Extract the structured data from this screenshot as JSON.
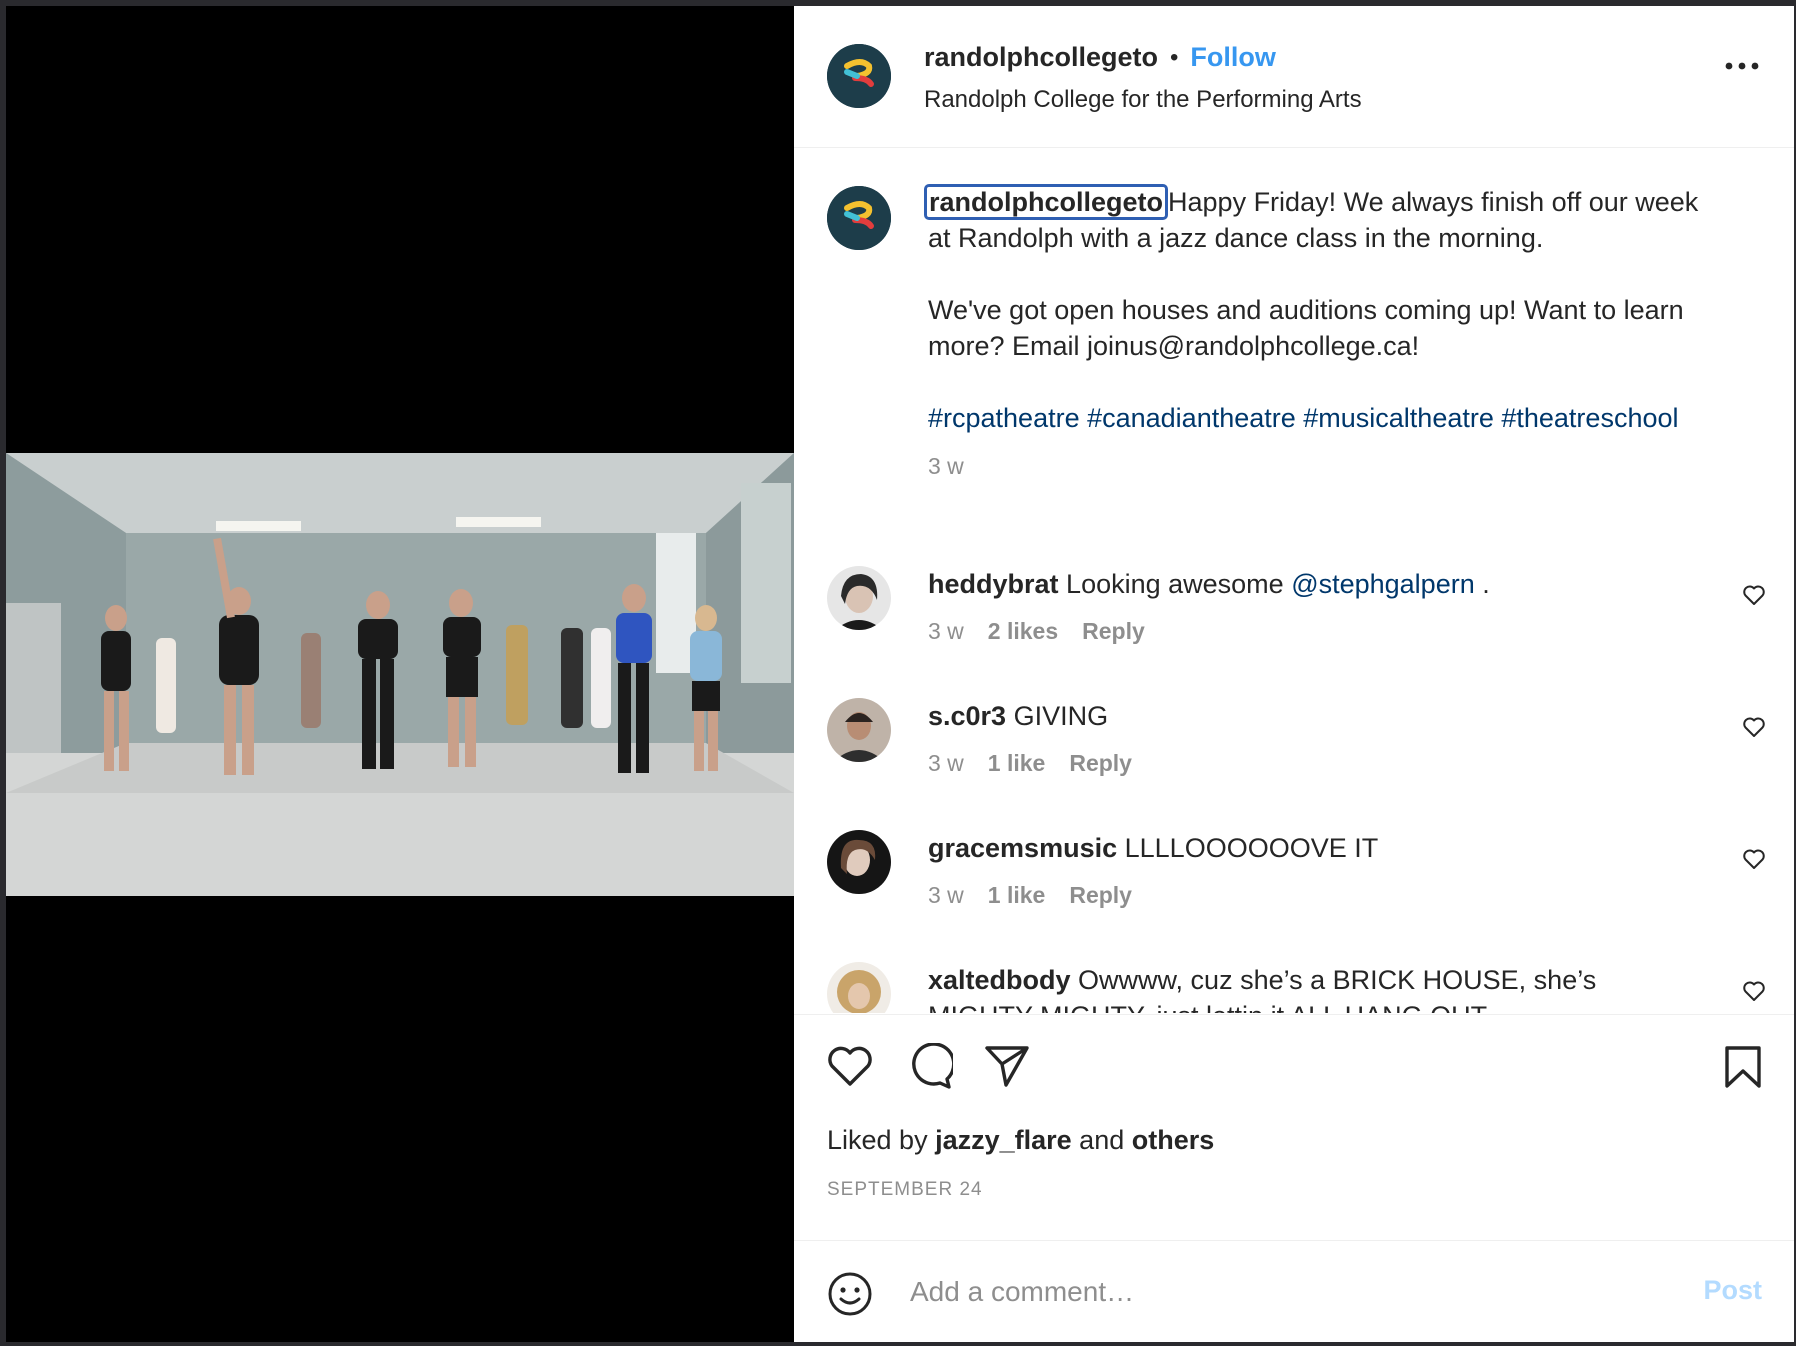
{
  "post": {
    "username": "randolphcollegeto",
    "follow_label": "Follow",
    "separator": "•",
    "subtitle": "Randolph College for the Performing Arts"
  },
  "caption": {
    "username": "randolphcollegeto",
    "line1": "Happy Friday! We always finish off our week at Randolph with a jazz dance class in the morning.",
    "line2": "We've got open houses and auditions coming up! Want to learn more? Email joinus@randolphcollege.ca!",
    "tags": "#rcpatheatre #canadiantheatre #musicaltheatre #theatreschool",
    "time": "3 w"
  },
  "comments": [
    {
      "username": "heddybrat",
      "text": "Looking awesome ",
      "mention": "@stephgalpern",
      "tail": " .",
      "time": "3 w",
      "likes": "2 likes",
      "reply": "Reply"
    },
    {
      "username": "s.c0r3",
      "text": "GIVING",
      "time": "3 w",
      "likes": "1 like",
      "reply": "Reply"
    },
    {
      "username": "gracemsmusic",
      "text": "LLLLOOOOOOVE IT",
      "time": "3 w",
      "likes": "1 like",
      "reply": "Reply"
    },
    {
      "username": "xaltedbody",
      "text": "Owwww, cuz she’s a BRICK HOUSE, she’s MIGHTY MIGHTY, just lettin it ALL HANG OUT"
    }
  ],
  "footer": {
    "liked_prefix": "Liked by ",
    "liked_user": "jazzy_flare",
    "liked_mid": " and ",
    "liked_others": "others",
    "date": "SEPTEMBER 24"
  },
  "add_comment": {
    "placeholder": "Add a comment…",
    "post_label": "Post"
  },
  "colors": {
    "accent": "#3797f0",
    "link": "#00376b",
    "muted": "#8e8e8e",
    "post_disabled": "#b3dbff",
    "logo_bg": "#1d3d4a"
  }
}
